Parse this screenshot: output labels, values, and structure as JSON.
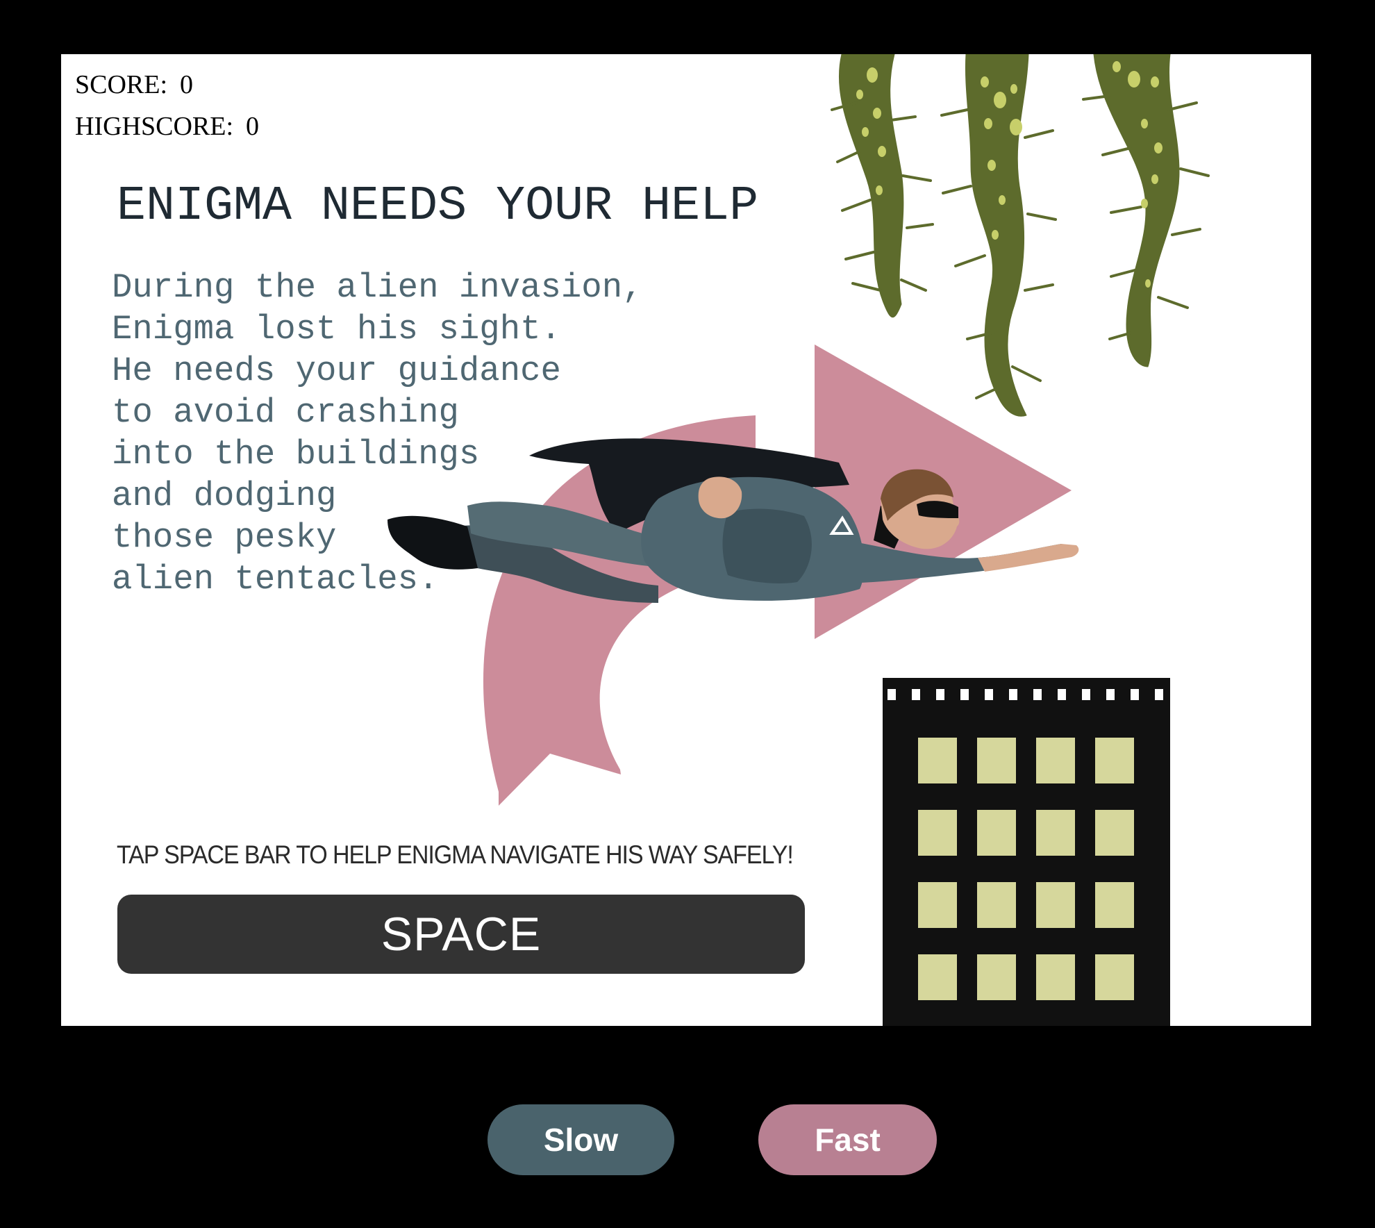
{
  "hud": {
    "score_label": "SCORE:",
    "score_value": "0",
    "highscore_label": "HIGHSCORE:",
    "highscore_value": "0"
  },
  "intro": {
    "title": "ENIGMA NEEDS YOUR HELP",
    "story_lines": [
      "During the alien invasion,",
      "Enigma lost his sight.",
      "He needs your guidance",
      "to avoid crashing",
      "into the buildings",
      "and dodging",
      "those pesky",
      "alien tentacles."
    ],
    "instruction": "TAP SPACE BAR TO HELP ENIGMA NAVIGATE HIS WAY SAFELY!",
    "key_label": "SPACE"
  },
  "speed_controls": {
    "slow_label": "Slow",
    "fast_label": "Fast"
  },
  "colors": {
    "background": "#000000",
    "canvas": "#ffffff",
    "tentacle": "#5d6b2c",
    "tentacle_spots": "#c7cf6a",
    "arrow": "#cc8c9a",
    "building": "#111111",
    "building_window": "#d6d79c",
    "slow_button": "#4a636c",
    "fast_button": "#b88092"
  },
  "icons": [
    "alien-tentacle-icon",
    "curved-arrow-icon",
    "flying-superhero-icon",
    "building-icon"
  ]
}
